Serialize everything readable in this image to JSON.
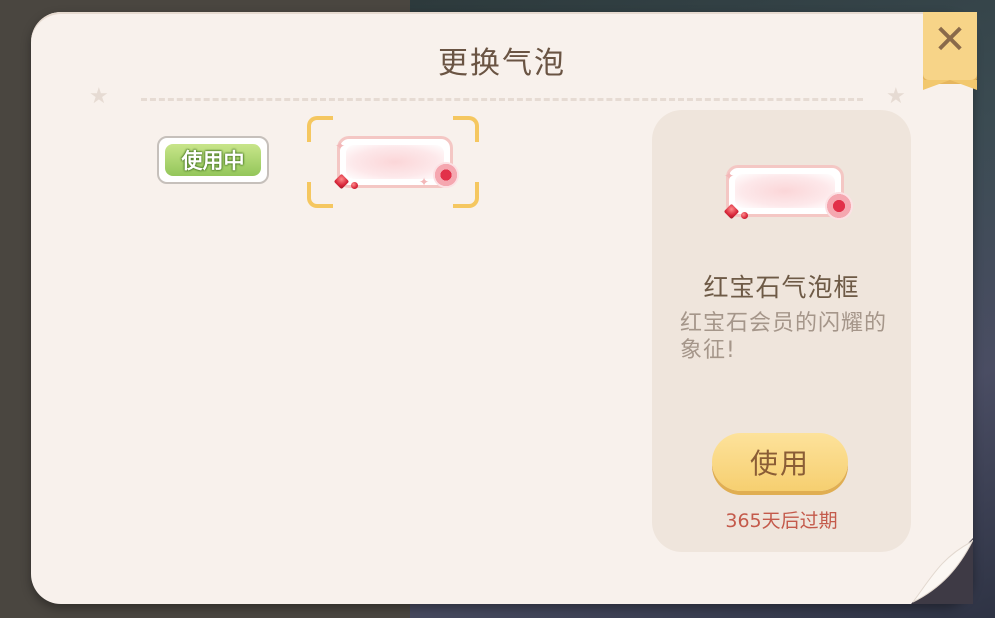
{
  "dialog": {
    "title": "更换气泡",
    "close_icon": "close-icon"
  },
  "bubble_list": {
    "current_badge": "使用中",
    "items": [
      {
        "icon": "ruby-bubble-frame",
        "selected": true
      }
    ]
  },
  "detail": {
    "name": "红宝石气泡框",
    "description": "红宝石会员的闪耀的象征!",
    "use_button": "使用",
    "expiry": "365天后过期"
  },
  "colors": {
    "panel": "#f8f1ec",
    "accent_gold": "#f5c760",
    "in_use_green": "#93c65a",
    "expiry_red": "#c45a4b"
  }
}
